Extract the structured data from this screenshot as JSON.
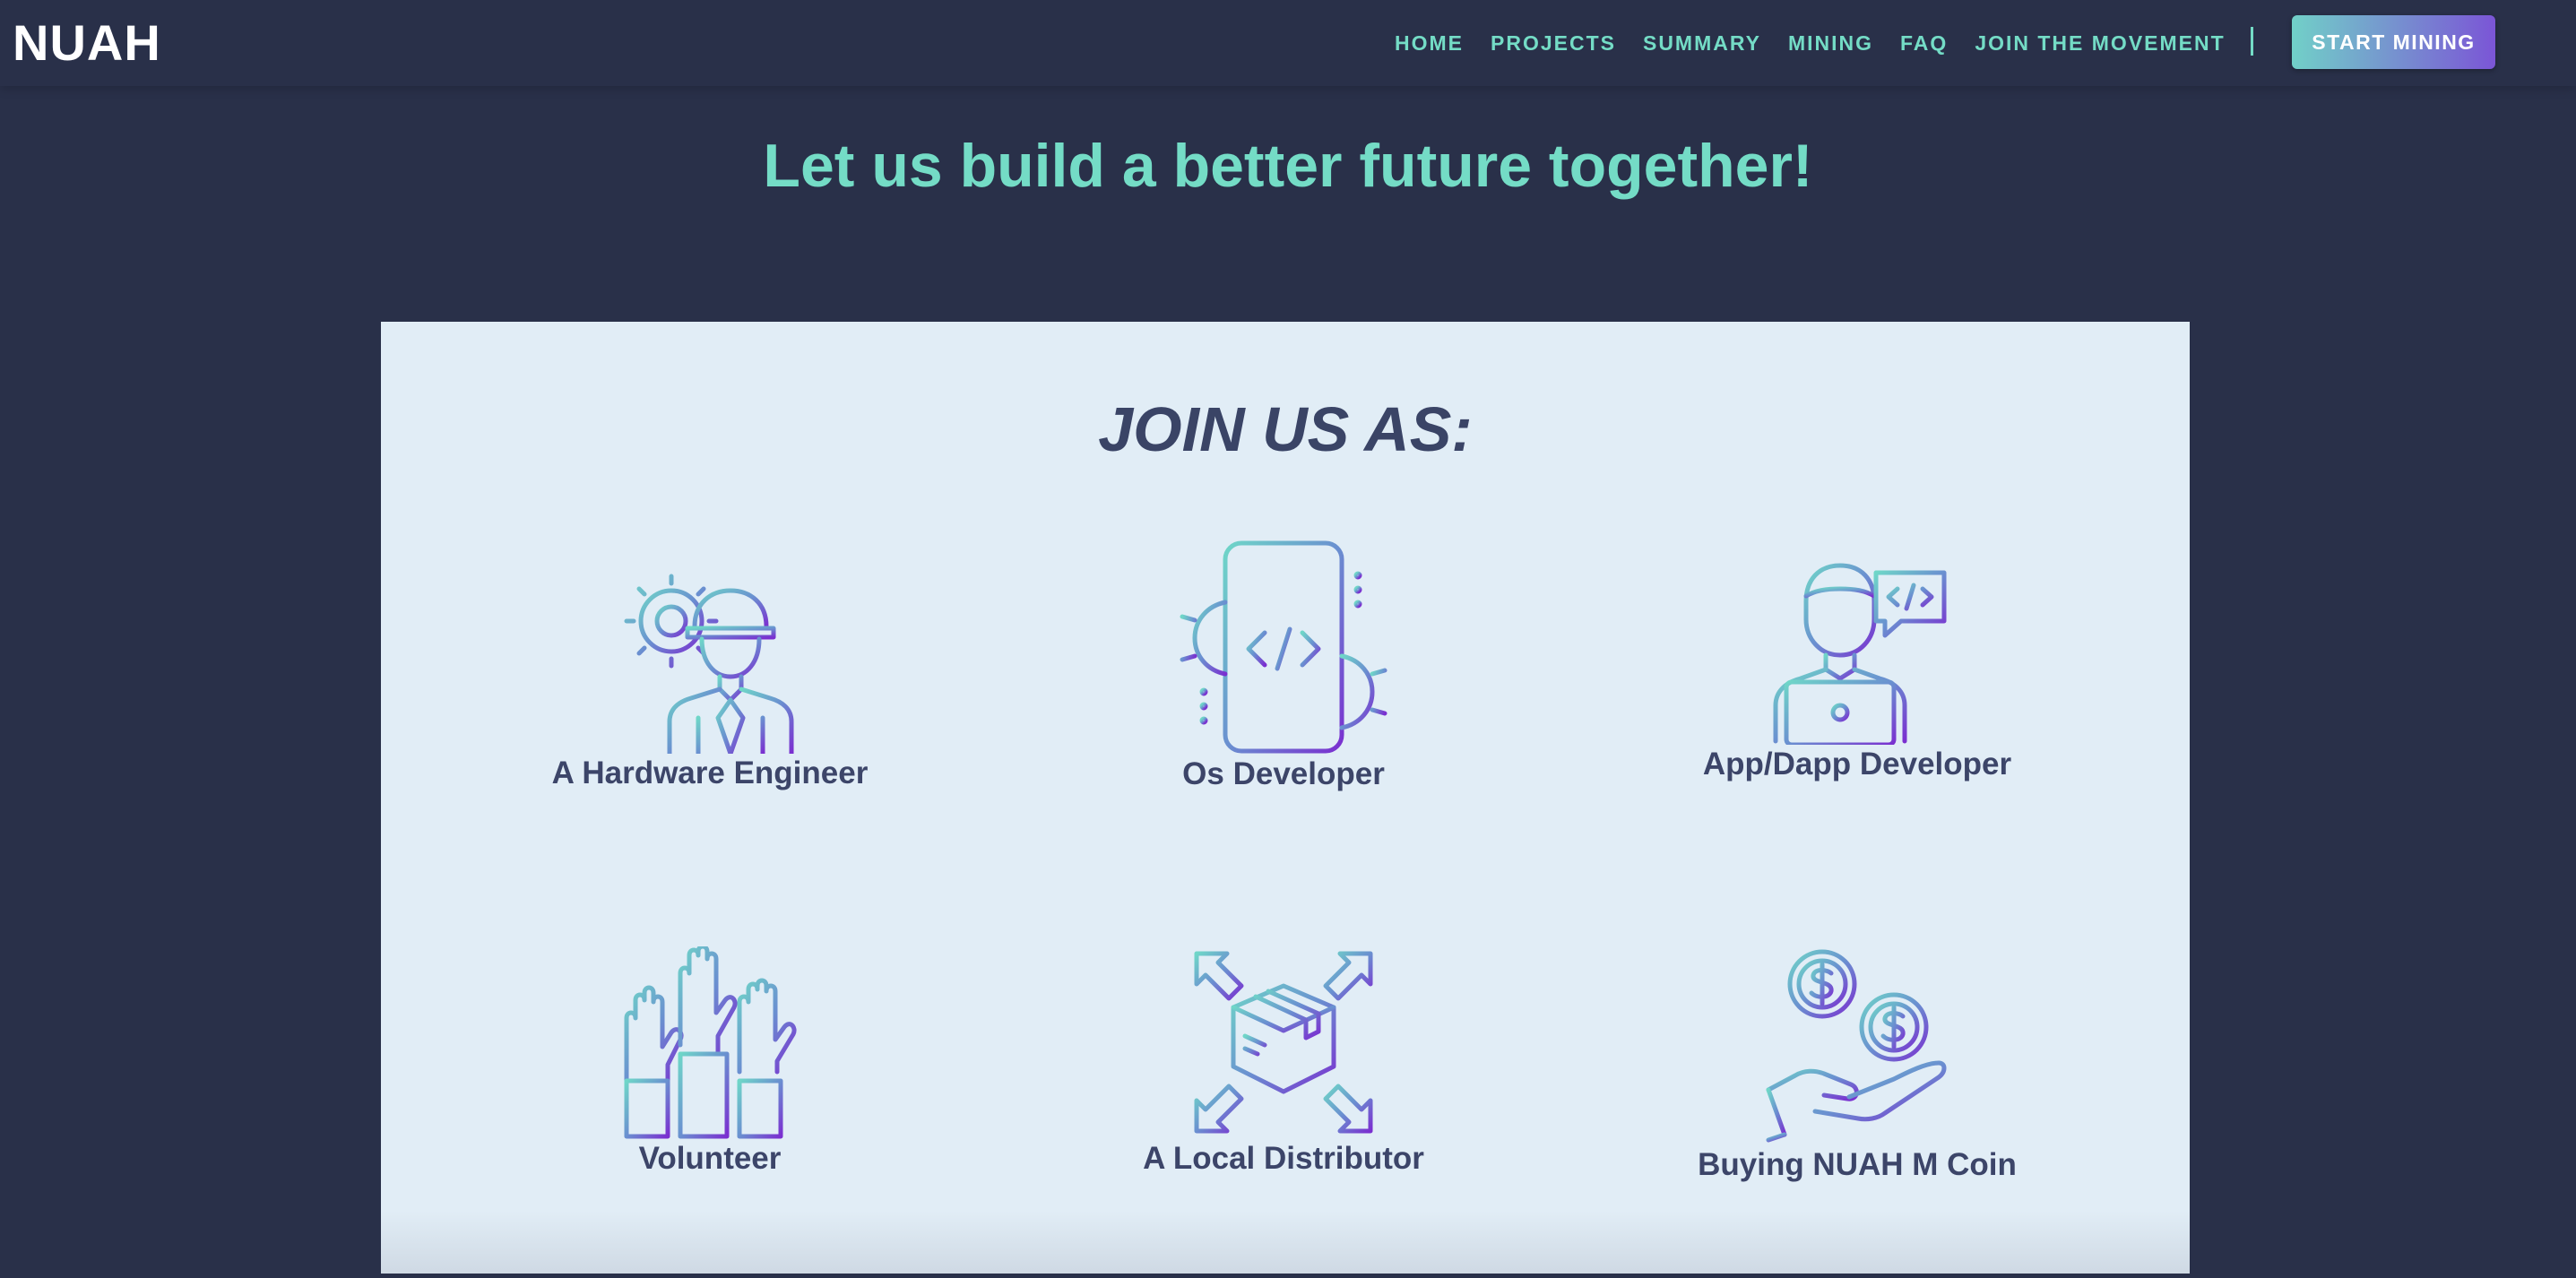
{
  "brand": {
    "logo": "NUAH"
  },
  "nav": {
    "items": [
      {
        "label": "HOME"
      },
      {
        "label": "PROJECTS"
      },
      {
        "label": "SUMMARY"
      },
      {
        "label": "MINING"
      },
      {
        "label": "FAQ"
      },
      {
        "label": "JOIN THE MOVEMENT"
      }
    ],
    "cta_label": "START MINING"
  },
  "hero": {
    "title": "Let us build a better future together!"
  },
  "join": {
    "title": "JOIN US AS:",
    "roles": [
      {
        "label": "A Hardware Engineer",
        "icon": "hardware-engineer-icon"
      },
      {
        "label": "Os Developer",
        "icon": "os-developer-phone-icon"
      },
      {
        "label": "App/Dapp Developer",
        "icon": "app-developer-icon"
      },
      {
        "label": "Volunteer",
        "icon": "raised-hands-icon"
      },
      {
        "label": "A Local Distributor",
        "icon": "distribution-box-icon"
      },
      {
        "label": "Buying NUAH M Coin",
        "icon": "coin-hand-icon"
      }
    ]
  },
  "colors": {
    "background": "#293049",
    "accent": "#74dcc6",
    "card": "#e1edf6",
    "text_dark": "#3c4569",
    "gradient_start": "#6fd6c8",
    "gradient_end": "#7a2fd0"
  }
}
